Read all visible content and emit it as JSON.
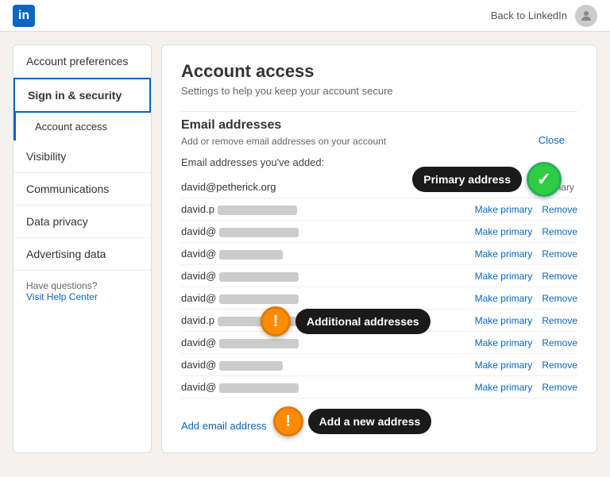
{
  "header": {
    "logo_letter": "in",
    "back_label": "Back to LinkedIn",
    "avatar_alt": "user avatar"
  },
  "sidebar": {
    "items": [
      {
        "id": "account-preferences",
        "label": "Account preferences",
        "active": false
      },
      {
        "id": "sign-in-security",
        "label": "Sign in & security",
        "active": true,
        "children": [
          {
            "id": "account-access",
            "label": "Account access",
            "active": true
          }
        ]
      },
      {
        "id": "visibility",
        "label": "Visibility",
        "active": false
      },
      {
        "id": "communications",
        "label": "Communications",
        "active": false
      },
      {
        "id": "data-privacy",
        "label": "Data privacy",
        "active": false
      },
      {
        "id": "advertising-data",
        "label": "Advertising data",
        "active": false
      }
    ],
    "help_label": "Have questions?",
    "help_link": "Visit Help Center"
  },
  "content": {
    "title": "Account access",
    "subtitle": "Settings to help you keep your account secure",
    "section_title": "Email addresses",
    "section_subtitle": "Add or remove email addresses on your account",
    "close_label": "Close",
    "email_label": "Email addresses you've added:",
    "primary_email": "david@petherick.org",
    "primary_badge": "Primary",
    "emails": [
      {
        "prefix": "david.p",
        "blurred": true,
        "blur_size": "medium"
      },
      {
        "prefix": "david@",
        "blurred": true,
        "blur_size": "medium"
      },
      {
        "prefix": "david@",
        "blurred": true,
        "blur_size": "short"
      },
      {
        "prefix": "david@",
        "blurred": true,
        "blur_size": "medium"
      },
      {
        "prefix": "david@",
        "blurred": true,
        "blur_size": "medium"
      },
      {
        "prefix": "david.p",
        "blurred": true,
        "blur_size": "medium"
      },
      {
        "prefix": "david@",
        "blurred": true,
        "blur_size": "medium"
      },
      {
        "prefix": "david@",
        "blurred": true,
        "blur_size": "short"
      },
      {
        "prefix": "david@",
        "blurred": true,
        "blur_size": "medium"
      }
    ],
    "make_primary_label": "Make primary",
    "remove_label": "Remove",
    "add_email_label": "Add email address",
    "tooltips": {
      "primary": {
        "text": "Primary address",
        "icon_type": "green",
        "icon_symbol": "✓"
      },
      "additional": {
        "text": "Additional addresses",
        "icon_type": "orange",
        "icon_symbol": "!"
      },
      "add_new": {
        "text": "Add a new address",
        "icon_type": "orange",
        "icon_symbol": "!"
      }
    }
  }
}
